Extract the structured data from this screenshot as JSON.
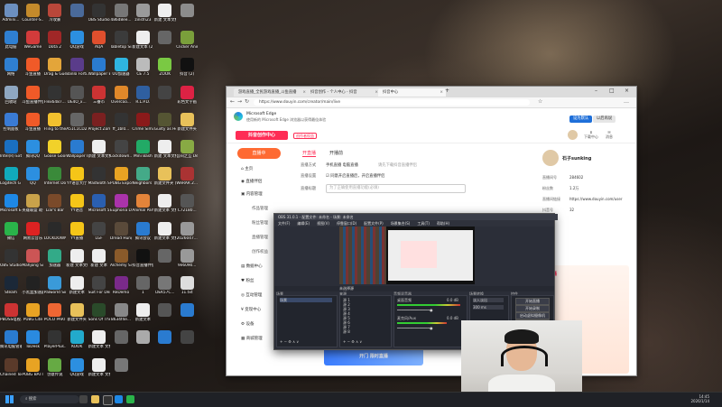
{
  "desktop": {
    "icons": [
      {
        "label": "Admini...",
        "color": "#6c8fbf",
        "col": 0,
        "row": 0
      },
      {
        "label": "Counter-S...",
        "color": "#c48a2b",
        "col": 1,
        "row": 0
      },
      {
        "label": "冷攻暴",
        "color": "#b9473a",
        "col": 2,
        "row": 0
      },
      {
        "label": "",
        "color": "#4a6a9a",
        "col": 3,
        "row": 0
      },
      {
        "label": "OBS Studio",
        "color": "#333",
        "col": 4,
        "row": 0
      },
      {
        "label": "486d8ee...",
        "color": "#777",
        "col": 5,
        "row": 0
      },
      {
        "label": "zinsfn23",
        "color": "#9a9a9a",
        "col": 6,
        "row": 0
      },
      {
        "label": "新建 文本文档",
        "color": "#eee",
        "col": 7,
        "row": 0
      },
      {
        "label": "",
        "color": "#8c8c8c",
        "col": 8,
        "row": 0
      },
      {
        "label": "此电脑",
        "color": "#2f7fd1",
        "col": 0,
        "row": 1
      },
      {
        "label": "WeGame",
        "color": "#d23b3b",
        "col": 1,
        "row": 1
      },
      {
        "label": "Dota 2",
        "color": "#a02727",
        "col": 2,
        "row": 1
      },
      {
        "label": "QQ游戏",
        "color": "#2c8fe0",
        "col": 3,
        "row": 1
      },
      {
        "label": "AQA",
        "color": "#e04f2d",
        "col": 4,
        "row": 1
      },
      {
        "label": "Tabletop Simulator",
        "color": "#3b3b3b",
        "col": 5,
        "row": 1
      },
      {
        "label": "新建文本 (2)",
        "color": "#eee",
        "col": 6,
        "row": 1
      },
      {
        "label": "",
        "color": "#666",
        "col": 7,
        "row": 1
      },
      {
        "label": "Clicker Animal...",
        "color": "#7a9f3b",
        "col": 8,
        "row": 1
      },
      {
        "label": "网络",
        "color": "#2f7fd1",
        "col": 0,
        "row": 2
      },
      {
        "label": "斗鱼直播",
        "color": "#f05a28",
        "col": 1,
        "row": 2
      },
      {
        "label": "Drag & Guess",
        "color": "#e3a53a",
        "col": 2,
        "row": 2
      },
      {
        "label": "Banlo Fortune",
        "color": "#5a3c8a",
        "col": 3,
        "row": 2
      },
      {
        "label": "Wallpaper Engine",
        "color": "#2a7bd0",
        "col": 4,
        "row": 2
      },
      {
        "label": "UU加速器",
        "color": "#2fb5e0",
        "col": 5,
        "row": 2
      },
      {
        "label": "CE 7.5",
        "color": "#bbb",
        "col": 6,
        "row": 2
      },
      {
        "label": "ZOOK",
        "color": "#7ac943",
        "col": 7,
        "row": 2
      },
      {
        "label": "抖音 (2)",
        "color": "#111",
        "col": 8,
        "row": 2
      },
      {
        "label": "回收站",
        "color": "#8fa7c1",
        "col": 0,
        "row": 3
      },
      {
        "label": "斗鱼直播伴侣",
        "color": "#f05a28",
        "col": 1,
        "row": 3
      },
      {
        "label": "Flex6487...",
        "color": "#333",
        "col": 2,
        "row": 3
      },
      {
        "label": "UE4O_x...",
        "color": "#555",
        "col": 3,
        "row": 3
      },
      {
        "label": "三番市",
        "color": "#c33",
        "col": 4,
        "row": 3
      },
      {
        "label": "Overcoo...",
        "color": "#e0882a",
        "col": 5,
        "row": 3
      },
      {
        "label": "R.L.P.D.",
        "color": "#2f5fa0",
        "col": 6,
        "row": 3
      },
      {
        "label": "",
        "color": "#444",
        "col": 7,
        "row": 3
      },
      {
        "label": "彩色文字画",
        "color": "#d24",
        "col": 8,
        "row": 3
      },
      {
        "label": "控制面板",
        "color": "#3a7bd5",
        "col": 0,
        "row": 4
      },
      {
        "label": "斗鱼直播",
        "color": "#f05a28",
        "col": 1,
        "row": 4
      },
      {
        "label": "Fling to the Finish",
        "color": "#f2c12e",
        "col": 2,
        "row": 4
      },
      {
        "label": "A51C1CD2...",
        "color": "#666",
        "col": 3,
        "row": 4
      },
      {
        "label": "Project Zomboid",
        "color": "#7a2020",
        "col": 4,
        "row": 4
      },
      {
        "label": "ff_1bl0...",
        "color": "#333",
        "col": 5,
        "row": 4
      },
      {
        "label": "Crime Simulator",
        "color": "#8a1a1a",
        "col": 6,
        "row": 4
      },
      {
        "label": "Guilty as Hell",
        "color": "#553",
        "col": 7,
        "row": 4
      },
      {
        "label": "新建文件夹",
        "color": "#e8c15a",
        "col": 8,
        "row": 4
      },
      {
        "label": "Intel(R) Extre...",
        "color": "#1a6fc0",
        "col": 0,
        "row": 5
      },
      {
        "label": "腾讯QQ",
        "color": "#2c8fe0",
        "col": 1,
        "row": 5
      },
      {
        "label": "Goose Goose Duck",
        "color": "#f1d12a",
        "col": 2,
        "row": 5
      },
      {
        "label": "Wallpaper Engine",
        "color": "#2a7bd0",
        "col": 3,
        "row": 5
      },
      {
        "label": "新建 文本文档",
        "color": "#eee",
        "col": 4,
        "row": 5
      },
      {
        "label": "Lockdown...",
        "color": "#444",
        "col": 5,
        "row": 5
      },
      {
        "label": "Mini Bash",
        "color": "#2a6",
        "col": 6,
        "row": 5
      },
      {
        "label": "新建 文本文档",
        "color": "#eee",
        "col": 7,
        "row": 5
      },
      {
        "label": "吾间之互 Demo",
        "color": "#8a4",
        "col": 8,
        "row": 5
      },
      {
        "label": "Logitech G HUB",
        "color": "#1ab",
        "col": 0,
        "row": 6
      },
      {
        "label": "QQ",
        "color": "#2c8fe0",
        "col": 1,
        "row": 6
      },
      {
        "label": "Internet Downlo...",
        "color": "#3a8a3a",
        "col": 2,
        "row": 6
      },
      {
        "label": "YY语音大厅",
        "color": "#f5c518",
        "col": 3,
        "row": 6
      },
      {
        "label": "MadSloth Shadow",
        "color": "#333",
        "col": 4,
        "row": 6
      },
      {
        "label": "PUBG Export",
        "color": "#e8a323",
        "col": 5,
        "row": 6
      },
      {
        "label": "Neighbors Suburba...",
        "color": "#4a8",
        "col": 6,
        "row": 6
      },
      {
        "label": "新建文件夹 (2)",
        "color": "#e8c15a",
        "col": 7,
        "row": 6
      },
      {
        "label": "WeRAR 2...",
        "color": "#a33",
        "col": 8,
        "row": 6
      },
      {
        "label": "Microsoft Edge",
        "color": "#1e88e5",
        "col": 0,
        "row": 7
      },
      {
        "label": "英雄联盟 助手",
        "color": "#c9a24a",
        "col": 1,
        "row": 7
      },
      {
        "label": "Liar's Bar",
        "color": "#7a4a2a",
        "col": 2,
        "row": 7
      },
      {
        "label": "YY语音",
        "color": "#f5c518",
        "col": 3,
        "row": 7
      },
      {
        "label": "Microsoft 5",
        "color": "#2a5fb0",
        "col": 4,
        "row": 7
      },
      {
        "label": "Euphoria Demo",
        "color": "#a3a",
        "col": 5,
        "row": 7
      },
      {
        "label": "Animal Party",
        "color": "#e3843a",
        "col": 6,
        "row": 7
      },
      {
        "label": "新建文本 文档",
        "color": "#eee",
        "col": 7,
        "row": 7
      },
      {
        "label": "C72180...",
        "color": "#555",
        "col": 8,
        "row": 7
      },
      {
        "label": "微信",
        "color": "#2ab34a",
        "col": 0,
        "row": 8
      },
      {
        "label": "网易云音乐",
        "color": "#d22",
        "col": 1,
        "row": 8
      },
      {
        "label": "LOCKDOWN Protocol",
        "color": "#2a2a2a",
        "col": 2,
        "row": 8
      },
      {
        "label": "YY直播",
        "color": "#f5c518",
        "col": 3,
        "row": 8
      },
      {
        "label": "LGF",
        "color": "#444",
        "col": 4,
        "row": 8
      },
      {
        "label": "Dread Hunger",
        "color": "#5a4a3a",
        "col": 5,
        "row": 8
      },
      {
        "label": "腾讯会议",
        "color": "#2a7bd0",
        "col": 6,
        "row": 8
      },
      {
        "label": "新建文本 文档",
        "color": "#eee",
        "col": 7,
        "row": 8
      },
      {
        "label": "2026047...",
        "color": "#999",
        "col": 8,
        "row": 8
      },
      {
        "label": "OBS Studio",
        "color": "#333",
        "col": 0,
        "row": 9
      },
      {
        "label": "Mahjong Soul",
        "color": "#c55",
        "col": 1,
        "row": 9
      },
      {
        "label": "加速器",
        "color": "#3a8",
        "col": 2,
        "row": 9
      },
      {
        "label": "新建 文本文档",
        "color": "#eee",
        "col": 3,
        "row": 9
      },
      {
        "label": "新建 文本",
        "color": "#eee",
        "col": 4,
        "row": 9
      },
      {
        "label": "Alchemy Simulat...",
        "color": "#8a5a2a",
        "col": 5,
        "row": 9
      },
      {
        "label": "抖音直播伴侣",
        "color": "#111",
        "col": 6,
        "row": 9
      },
      {
        "label": "",
        "color": "#666",
        "col": 7,
        "row": 9
      },
      {
        "label": "9e6090...",
        "color": "#999",
        "col": 8,
        "row": 9
      },
      {
        "label": "Steam",
        "color": "#1b2838",
        "col": 0,
        "row": 10
      },
      {
        "label": "小黑盒加速器",
        "color": "#222",
        "col": 1,
        "row": 10
      },
      {
        "label": "Palworld Simulator",
        "color": "#3a9ad9",
        "col": 2,
        "row": 10
      },
      {
        "label": "新建文本",
        "color": "#eee",
        "col": 3,
        "row": 10
      },
      {
        "label": "Suit For Demo",
        "color": "#444",
        "col": 4,
        "row": 10
      },
      {
        "label": "ReDemo",
        "color": "#7a2a8a",
        "col": 5,
        "row": 10
      },
      {
        "label": "1",
        "color": "#666",
        "col": 6,
        "row": 10
      },
      {
        "label": "DEK57C...",
        "color": "#777",
        "col": 7,
        "row": 10
      },
      {
        "label": "11.txt",
        "color": "#ddd",
        "col": 8,
        "row": 10
      },
      {
        "label": "PBOSS电视...",
        "color": "#c33",
        "col": 0,
        "row": 11
      },
      {
        "label": "PUBG Lite",
        "color": "#e8a323",
        "col": 1,
        "row": 11
      },
      {
        "label": "POCO PARTY",
        "color": "#e63",
        "col": 2,
        "row": 11
      },
      {
        "label": "新建文件夹",
        "color": "#e8c15a",
        "col": 3,
        "row": 11
      },
      {
        "label": "Sons Of The Forest",
        "color": "#2a4a2a",
        "col": 4,
        "row": 11
      },
      {
        "label": "8634f4e...",
        "color": "#888",
        "col": 5,
        "row": 11
      },
      {
        "label": "新建文本",
        "color": "#eee",
        "col": 6,
        "row": 11
      },
      {
        "label": "",
        "color": "#555",
        "col": 7,
        "row": 11
      },
      {
        "label": "",
        "color": "#2a7bd0",
        "col": 8,
        "row": 11
      },
      {
        "label": "腾讯电脑管家",
        "color": "#2a7bd0",
        "col": 0,
        "row": 12
      },
      {
        "label": "ToDesk",
        "color": "#2a8ae0",
        "col": 1,
        "row": 12
      },
      {
        "label": "PlayerPlus...",
        "color": "#333",
        "col": 2,
        "row": 12
      },
      {
        "label": "KOOK",
        "color": "#2ac",
        "col": 3,
        "row": 12
      },
      {
        "label": "新建文本 文档",
        "color": "#eee",
        "col": 4,
        "row": 12
      },
      {
        "label": "",
        "color": "#666",
        "col": 5,
        "row": 12
      },
      {
        "label": "",
        "color": "#aaa",
        "col": 6,
        "row": 12
      },
      {
        "label": "",
        "color": "#2a7bd0",
        "col": 7,
        "row": 12
      },
      {
        "label": "",
        "color": "#444",
        "col": 8,
        "row": 12
      },
      {
        "label": "Chained Together",
        "color": "#5a3a2a",
        "col": 0,
        "row": 13
      },
      {
        "label": "PUBG BATTLEGR...",
        "color": "#e8a323",
        "col": 1,
        "row": 13
      },
      {
        "label": "创意传说",
        "color": "#6a4",
        "col": 2,
        "row": 13
      },
      {
        "label": "QQ游戏",
        "color": "#2c8fe0",
        "col": 3,
        "row": 13
      },
      {
        "label": "新建文本 文档",
        "color": "#eee",
        "col": 4,
        "row": 13
      },
      {
        "label": "",
        "color": "#777",
        "col": 5,
        "row": 13
      }
    ]
  },
  "edge": {
    "tabs": [
      {
        "label": "游戏直播_全民游戏直播_斗鱼直播",
        "active": false
      },
      {
        "label": "抖音创作 - 个人中心 - 抖音",
        "active": false
      },
      {
        "label": "抖音中心",
        "active": true
      }
    ],
    "address": "https://www.douyin.com/creator/main/live",
    "promo_title": "Microsoft Edge",
    "promo_sub": "使用新的 Microsoft Edge 浏览器以获得最佳体验",
    "brand": "抖音创作中心",
    "brand_tag": "创作者权益",
    "top_btn_primary": "设为默认",
    "top_btn_secondary": "以后再说",
    "header_icons": [
      "下载中心",
      "消息"
    ],
    "create_button": "直播中",
    "nav": [
      "主页",
      "直播伴侣",
      "内容管理",
      "作品管理",
      "粉丝管理",
      "直播管理",
      "创作权益",
      "数据中心",
      "粉丝",
      "互动管理",
      "变现中心",
      "设备",
      "商城管理"
    ],
    "content_tabs": [
      "开直播",
      "开播前"
    ],
    "form": [
      {
        "label": "直播方式",
        "value": "手机直播 电脑直播",
        "extra": "请先下载抖音直播伴侣"
      },
      {
        "label": "直播设置",
        "value": "是否开启"
      },
      {
        "label": "直播标题",
        "placeholder": "为了正确使用直播功能(必填)"
      }
    ],
    "checkbox_text": "同意开启直播后，开启直播伴侣",
    "right_panel": {
      "name": "石子sunking",
      "rows": [
        {
          "label": "直播间号",
          "value": "284602"
        },
        {
          "label": "粉丝数",
          "value": "1.2万"
        },
        {
          "label": "直播间链接",
          "value": "https://www.douyin.com/user"
        },
        {
          "label": "抖音号",
          "value": "32"
        }
      ],
      "banner_title": "开播"
    },
    "promo_banner": "开门 限时直播"
  },
  "obs": {
    "title": "OBS 31.0.1 - 配置文件: 未命名 - 场景: 未命名",
    "menu": [
      "文件(F)",
      "编辑(E)",
      "视图(V)",
      "停靠窗口(D)",
      "配置文件(P)",
      "场景集合(S)",
      "工具(T)",
      "帮助(H)"
    ],
    "panels": [
      "场景",
      "来源",
      "音频混音器",
      "场景转换",
      "控件"
    ],
    "scenes": [
      "场景"
    ],
    "sources": [
      "源 1",
      "源 2",
      "源 3",
      "源 4",
      "源 5",
      "源 6",
      "源 7",
      "源 8"
    ],
    "mixer": [
      {
        "name": "桌面音频",
        "db": "0.0 dB",
        "level": 0.7
      },
      {
        "name": "麦克风/Aux",
        "db": "0.0 dB",
        "level": 0.55
      }
    ],
    "transition": {
      "type": "淡入淡出",
      "duration": "300 ms"
    },
    "controls": [
      "开始直播",
      "开始录制",
      "启动虚拟摄像机",
      "工作室模式",
      "设置",
      "退出"
    ],
    "preview_tab": "未选择源"
  },
  "taskbar": {
    "search": "搜索",
    "time": "14:45",
    "date": "2026/1/14"
  }
}
